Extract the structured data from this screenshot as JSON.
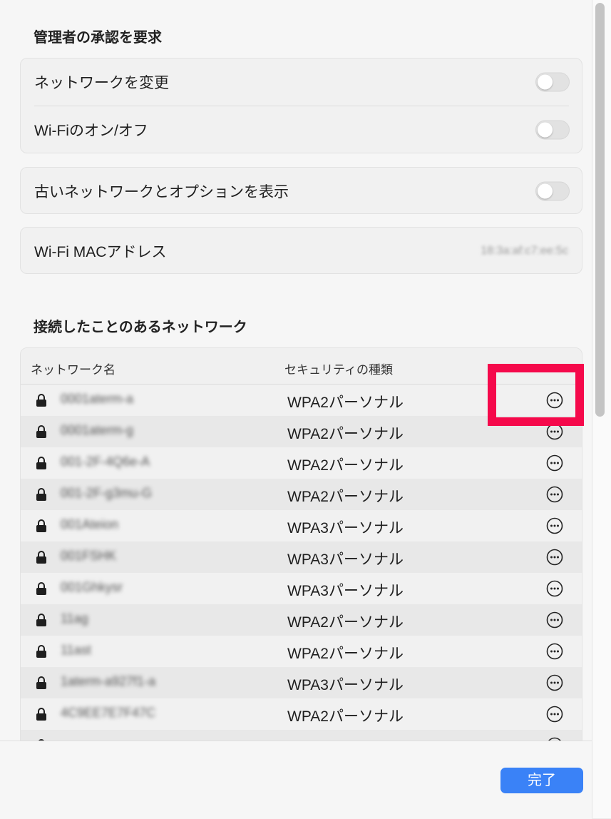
{
  "admin_section": {
    "title": "管理者の承認を要求",
    "change_network_label": "ネットワークを変更",
    "change_network_on": false,
    "wifi_onoff_label": "Wi-Fiのオン/オフ",
    "wifi_onoff_on": false
  },
  "legacy": {
    "label": "古いネットワークとオプションを表示",
    "on": false
  },
  "mac": {
    "label": "Wi-Fi MACアドレス",
    "value": "18:3a:af:c7:ee:5c"
  },
  "known_networks": {
    "title": "接続したことのあるネットワーク",
    "col_name": "ネットワーク名",
    "col_security": "セキュリティの種類",
    "rows": [
      {
        "name": "0001aterm-a",
        "security": "WPA2パーソナル"
      },
      {
        "name": "0001aterm-g",
        "security": "WPA2パーソナル"
      },
      {
        "name": "001-2F-4Q6e-A",
        "security": "WPA2パーソナル"
      },
      {
        "name": "001-2F-g3mu-G",
        "security": "WPA2パーソナル"
      },
      {
        "name": "001Ateion",
        "security": "WPA3パーソナル"
      },
      {
        "name": "001FSHK",
        "security": "WPA3パーソナル"
      },
      {
        "name": "001Ghkysr",
        "security": "WPA3パーソナル"
      },
      {
        "name": "11ag",
        "security": "WPA2パーソナル"
      },
      {
        "name": "11ast",
        "security": "WPA2パーソナル"
      },
      {
        "name": "1aterm-a927f1-a",
        "security": "WPA3パーソナル"
      },
      {
        "name": "4C9EE7E7F47C",
        "security": "WPA2パーソナル"
      },
      {
        "name": "",
        "security": ""
      }
    ]
  },
  "footer": {
    "done_label": "完了"
  },
  "colors": {
    "accent": "#3a82f7",
    "highlight": "#f5094b"
  },
  "icons": {
    "lock": "lock-icon",
    "more": "ellipsis-circle-icon"
  }
}
